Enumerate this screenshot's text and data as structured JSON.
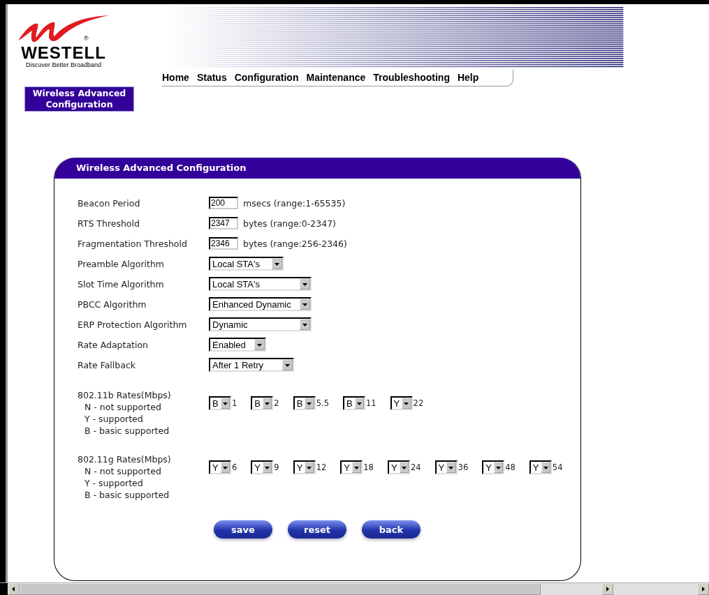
{
  "brand": {
    "name": "WESTELL",
    "mark": "®",
    "tagline": "Discover Better Broadband"
  },
  "nav": [
    "Home",
    "Status",
    "Configuration",
    "Maintenance",
    "Troubleshooting",
    "Help"
  ],
  "page_tab": "Wireless Advanced Configuration",
  "panel": {
    "title": "Wireless Advanced Configuration",
    "fields": [
      {
        "kind": "text",
        "label": "Beacon Period",
        "value": "200",
        "unit": "msecs (range:1-65535)"
      },
      {
        "kind": "text",
        "label": "RTS Threshold",
        "value": "2347",
        "unit": "bytes (range:0-2347)"
      },
      {
        "kind": "text",
        "label": "Fragmentation Threshold",
        "value": "2346",
        "unit": "bytes (range:256-2346)"
      },
      {
        "kind": "select",
        "label": "Preamble Algorithm",
        "value": "Local STA's"
      },
      {
        "kind": "select",
        "label": "Slot Time Algorithm",
        "value": "Local STA's"
      },
      {
        "kind": "select",
        "label": "PBCC Algorithm",
        "value": "Enhanced Dynamic"
      },
      {
        "kind": "select",
        "label": "ERP Protection Algorithm",
        "value": "Dynamic"
      },
      {
        "kind": "select",
        "label": "Rate Adaptation",
        "value": "Enabled"
      },
      {
        "kind": "select",
        "label": "Rate Fallback",
        "value": "After 1 Retry"
      }
    ],
    "rate_groups": [
      {
        "title": "802.11b Rates(Mbps)",
        "legend": [
          "N - not supported",
          "Y - supported",
          "B - basic supported"
        ],
        "rates": [
          {
            "value": "B",
            "label": "1"
          },
          {
            "value": "B",
            "label": "2"
          },
          {
            "value": "B",
            "label": "5.5"
          },
          {
            "value": "B",
            "label": "11"
          },
          {
            "value": "Y",
            "label": "22"
          }
        ]
      },
      {
        "title": "802.11g Rates(Mbps)",
        "legend": [
          "N - not supported",
          "Y - supported",
          "B - basic supported"
        ],
        "rates": [
          {
            "value": "Y",
            "label": "6"
          },
          {
            "value": "Y",
            "label": "9"
          },
          {
            "value": "Y",
            "label": "12"
          },
          {
            "value": "Y",
            "label": "18"
          },
          {
            "value": "Y",
            "label": "24"
          },
          {
            "value": "Y",
            "label": "36"
          },
          {
            "value": "Y",
            "label": "48"
          },
          {
            "value": "Y",
            "label": "54"
          }
        ]
      }
    ],
    "buttons": [
      "save",
      "reset",
      "back"
    ]
  }
}
